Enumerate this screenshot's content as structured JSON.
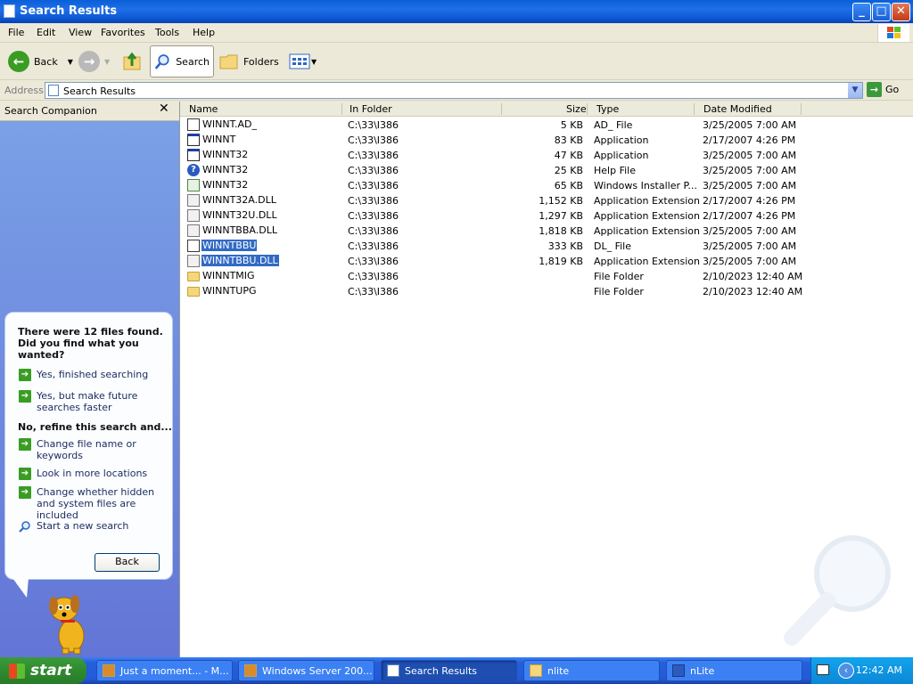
{
  "window": {
    "title": "Search Results",
    "buttons": {
      "minimize": "_",
      "maximize": "□",
      "close": "✕"
    }
  },
  "menubar": [
    "File",
    "Edit",
    "View",
    "Favorites",
    "Tools",
    "Help"
  ],
  "toolbar": {
    "back": "Back",
    "search": "Search",
    "folders": "Folders"
  },
  "address": {
    "label": "Address",
    "value": "Search Results",
    "go": "Go"
  },
  "sidebar": {
    "title": "Search Companion",
    "heading": "There were 12 files found. Did you find what you wanted?",
    "items_top": [
      "Yes, finished searching",
      "Yes, but make future searches faster"
    ],
    "refine_heading": "No, refine this search and...",
    "items_refine": [
      "Change file name or keywords",
      "Look in more locations",
      "Change whether hidden and system files are included"
    ],
    "new_search": "Start a new search",
    "back_button": "Back"
  },
  "columns": {
    "name": "Name",
    "folder": "In Folder",
    "size": "Size",
    "type": "Type",
    "date": "Date Modified"
  },
  "files": [
    {
      "icon": "file-icon",
      "name": "WINNT.AD_",
      "folder": "C:\\33\\I386",
      "size": "5 KB",
      "type": "AD_ File",
      "date": "3/25/2005 7:00 AM"
    },
    {
      "icon": "app-icon",
      "name": "WINNT",
      "folder": "C:\\33\\I386",
      "size": "83 KB",
      "type": "Application",
      "date": "2/17/2007 4:26 PM"
    },
    {
      "icon": "app-icon",
      "name": "WINNT32",
      "folder": "C:\\33\\I386",
      "size": "47 KB",
      "type": "Application",
      "date": "3/25/2005 7:00 AM"
    },
    {
      "icon": "help-icon",
      "name": "WINNT32",
      "folder": "C:\\33\\I386",
      "size": "25 KB",
      "type": "Help File",
      "date": "3/25/2005 7:00 AM"
    },
    {
      "icon": "msi-icon",
      "name": "WINNT32",
      "folder": "C:\\33\\I386",
      "size": "65 KB",
      "type": "Windows Installer P...",
      "date": "3/25/2005 7:00 AM"
    },
    {
      "icon": "dll-icon",
      "name": "WINNT32A.DLL",
      "folder": "C:\\33\\I386",
      "size": "1,152 KB",
      "type": "Application Extension",
      "date": "2/17/2007 4:26 PM"
    },
    {
      "icon": "dll-icon",
      "name": "WINNT32U.DLL",
      "folder": "C:\\33\\I386",
      "size": "1,297 KB",
      "type": "Application Extension",
      "date": "2/17/2007 4:26 PM"
    },
    {
      "icon": "dll-icon",
      "name": "WINNTBBA.DLL",
      "folder": "C:\\33\\I386",
      "size": "1,818 KB",
      "type": "Application Extension",
      "date": "3/25/2005 7:00 AM"
    },
    {
      "icon": "file-icon",
      "name": "WINNTBBU",
      "folder": "C:\\33\\I386",
      "size": "333 KB",
      "type": "DL_ File",
      "date": "3/25/2005 7:00 AM",
      "selected": true
    },
    {
      "icon": "dll-icon",
      "name": "WINNTBBU.DLL",
      "folder": "C:\\33\\I386",
      "size": "1,819 KB",
      "type": "Application Extension",
      "date": "3/25/2005 7:00 AM",
      "selected": true
    },
    {
      "icon": "folder-icon",
      "name": "WINNTMIG",
      "folder": "C:\\33\\I386",
      "size": "",
      "type": "File Folder",
      "date": "2/10/2023 12:40 AM"
    },
    {
      "icon": "folder-icon",
      "name": "WINNTUPG",
      "folder": "C:\\33\\I386",
      "size": "",
      "type": "File Folder",
      "date": "2/10/2023 12:40 AM"
    }
  ],
  "taskbar": {
    "start": "start",
    "tasks": [
      "Just a moment... - M...",
      "Windows Server 200...",
      "Search Results",
      "nlite",
      "nLite"
    ],
    "clock": "12:42 AM"
  },
  "colors": {
    "titlebar": "#0a5fd8",
    "selection": "#316ac5",
    "taskbar": "#245edb",
    "start": "#2f8a2f"
  }
}
